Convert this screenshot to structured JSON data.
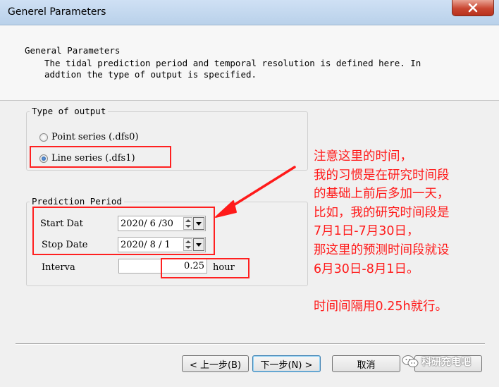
{
  "window": {
    "title": "Generel Parameters"
  },
  "header": {
    "title": "General Parameters",
    "line1": "The tidal prediction period and temporal resolution is defined here. In",
    "line2": "addtion the type of output is specified."
  },
  "output_type": {
    "legend": "Type of output",
    "options": [
      {
        "label": "Point series (.dfs0)",
        "selected": false
      },
      {
        "label": "Line series (.dfs1)",
        "selected": true
      }
    ]
  },
  "prediction_period": {
    "legend": "Prediction Period",
    "start_label": "Start Dat",
    "start_value": "2020/ 6 /30",
    "stop_label": "Stop Date",
    "stop_value": "2020/ 8 / 1",
    "interval_label": "Interva",
    "interval_value": "0.25",
    "interval_unit": "hour"
  },
  "annotation": {
    "lines": [
      "注意这里的时间，",
      "我的习惯是在研究时间段",
      "的基础上前后多加一天，",
      "比如，我的研究时间段是",
      "7月1日-7月30日，",
      "那这里的预测时间段就设",
      "6月30日-8月1日。",
      "",
      "时间间隔用0.25h就行。"
    ]
  },
  "buttons": {
    "back": "< 上一步(B)",
    "next": "下一步(N) >",
    "cancel": "取消"
  },
  "watermark": "科研充电吧",
  "colors": {
    "annotation": "#ff1a1a",
    "close": "#c94631"
  }
}
